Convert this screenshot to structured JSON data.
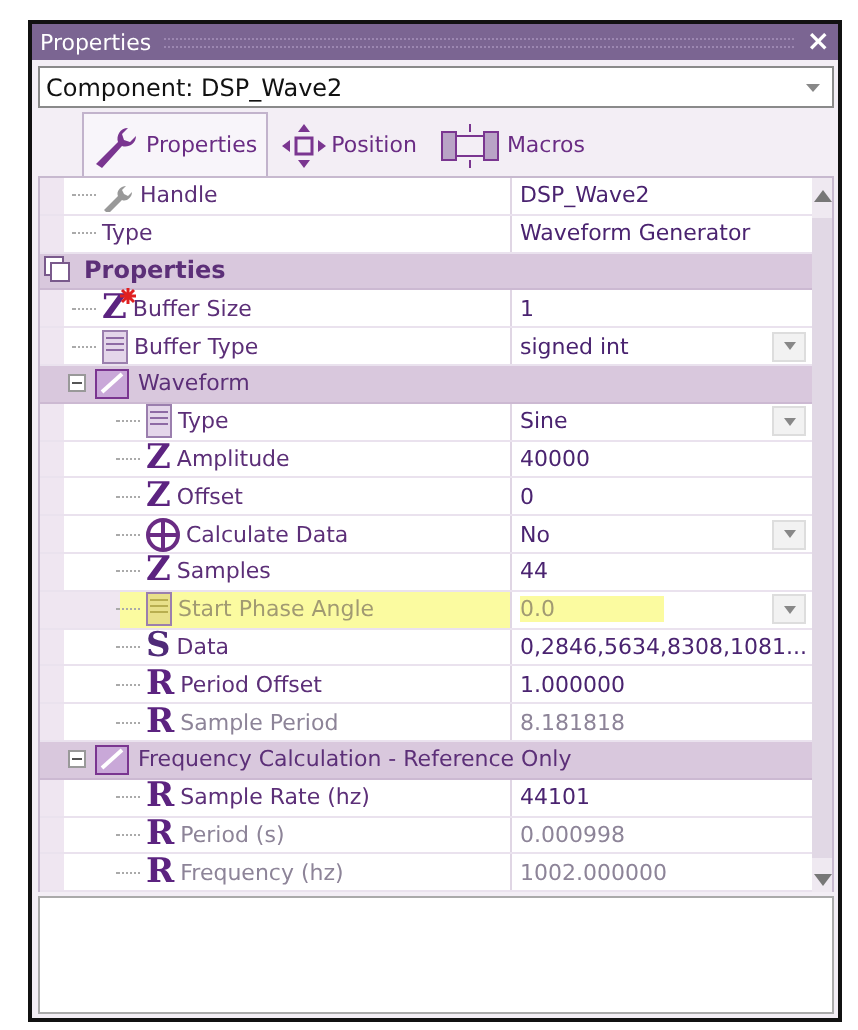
{
  "window": {
    "title": "Properties",
    "close": "×"
  },
  "component_selector": {
    "value": "Component: DSP_Wave2"
  },
  "tabs": [
    {
      "label": "Properties",
      "selected": true,
      "kind": "wrench"
    },
    {
      "label": "Position",
      "selected": false,
      "kind": "move"
    },
    {
      "label": "Macros",
      "selected": false,
      "kind": "macro"
    }
  ],
  "grid": {
    "items": [
      {
        "kind": "handle",
        "name": "Handle",
        "value": "DSP_Wave2",
        "disabled": false,
        "dropdown": false,
        "highlighted": false
      },
      {
        "kind": "plain",
        "name": "Type",
        "value": "Waveform Generator",
        "disabled": false,
        "dropdown": false,
        "highlighted": false
      },
      {
        "kind": "section",
        "name": "Properties",
        "children": [
          {
            "kind": "integer",
            "glyph": "Z",
            "marked": true,
            "name": "Buffer Size",
            "value": "1",
            "disabled": false,
            "dropdown": false,
            "highlighted": false
          },
          {
            "kind": "list",
            "name": "Buffer Type",
            "value": "signed int",
            "disabled": false,
            "dropdown": true,
            "highlighted": false
          },
          {
            "kind": "group",
            "expanded": true,
            "name": "Waveform",
            "children": [
              {
                "kind": "list",
                "name": "Type",
                "value": "Sine",
                "disabled": false,
                "dropdown": true,
                "highlighted": false
              },
              {
                "kind": "integer",
                "glyph": "Z",
                "name": "Amplitude",
                "value": "40000",
                "disabled": false,
                "dropdown": false,
                "highlighted": false
              },
              {
                "kind": "integer",
                "glyph": "Z",
                "name": "Offset",
                "value": "0",
                "disabled": false,
                "dropdown": false,
                "highlighted": false
              },
              {
                "kind": "choice",
                "name": "Calculate Data",
                "value": "No",
                "disabled": false,
                "dropdown": true,
                "highlighted": false
              },
              {
                "kind": "integer",
                "glyph": "Z",
                "name": "Samples",
                "value": "44",
                "disabled": false,
                "dropdown": false,
                "highlighted": false
              },
              {
                "kind": "list",
                "name": "Start Phase Angle",
                "value": "0.0",
                "disabled": true,
                "dropdown": true,
                "highlighted": true
              },
              {
                "kind": "string",
                "glyph": "S",
                "name": "Data",
                "value": "0,2846,5634,8308,1081...",
                "disabled": false,
                "dropdown": false,
                "highlighted": false
              },
              {
                "kind": "real",
                "glyph": "R",
                "name": "Period Offset",
                "value": "1.000000",
                "disabled": false,
                "dropdown": false,
                "highlighted": false
              },
              {
                "kind": "real",
                "glyph": "R",
                "name": "Sample Period",
                "value": "8.181818",
                "disabled": true,
                "dropdown": false,
                "highlighted": false
              }
            ]
          },
          {
            "kind": "group",
            "expanded": true,
            "name": "Frequency Calculation - Reference Only",
            "children": [
              {
                "kind": "real",
                "glyph": "R",
                "name": "Sample Rate (hz)",
                "value": "44101",
                "disabled": false,
                "dropdown": false,
                "highlighted": false
              },
              {
                "kind": "real",
                "glyph": "R",
                "name": "Period (s)",
                "value": "0.000998",
                "disabled": true,
                "dropdown": false,
                "highlighted": false
              },
              {
                "kind": "real",
                "glyph": "R",
                "name": "Frequency (hz)",
                "value": "1002.000000",
                "disabled": true,
                "dropdown": false,
                "highlighted": false
              }
            ]
          }
        ]
      }
    ]
  }
}
